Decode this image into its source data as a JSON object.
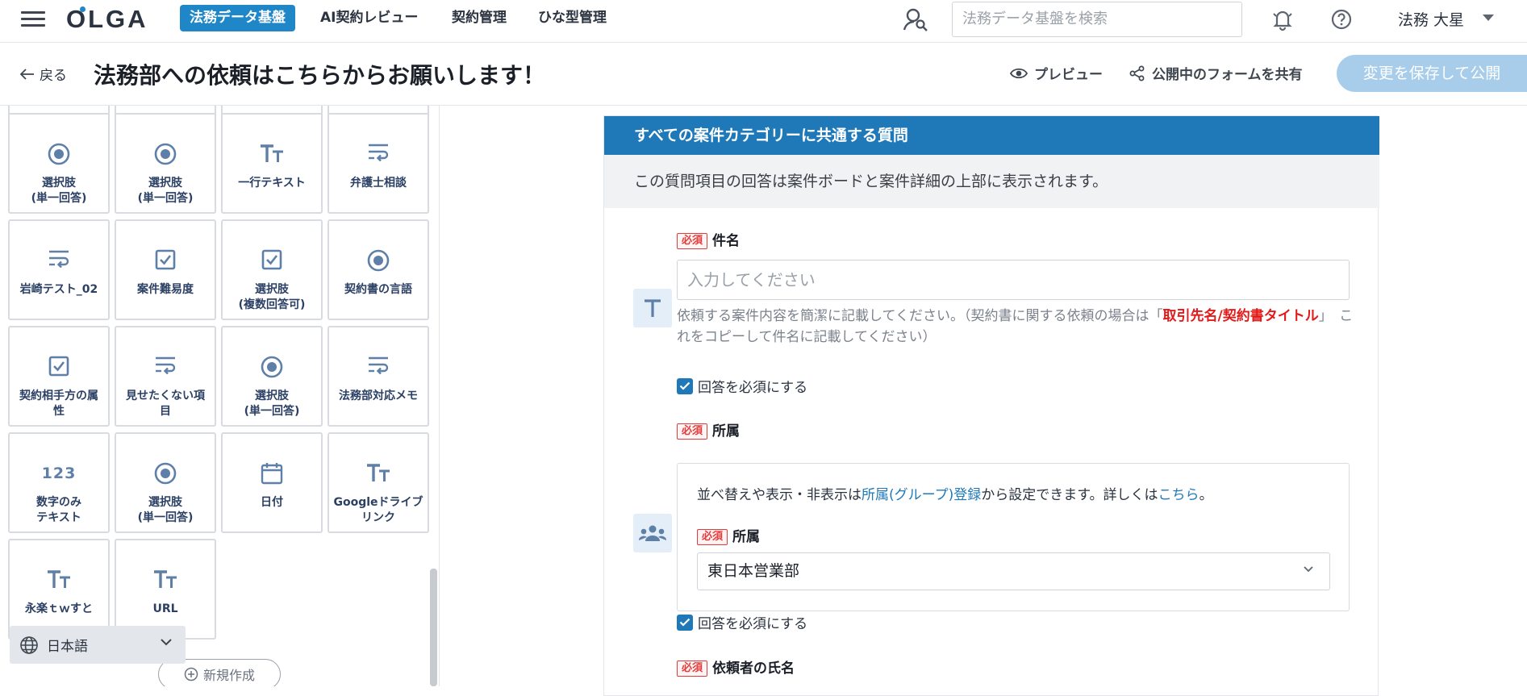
{
  "topnav": {
    "logo": "OLGA",
    "tabs": [
      {
        "label": "法務データ基盤",
        "active": true
      },
      {
        "label": "AI契約レビュー",
        "active": false
      },
      {
        "label": "契約管理",
        "active": false
      },
      {
        "label": "ひな型管理",
        "active": false
      }
    ],
    "search_placeholder": "法務データ基盤を検索",
    "user_name": "法務 大星",
    "brand_color": "#1f86c8"
  },
  "titlebar": {
    "back_label": "戻る",
    "title": "法務部への依頼はこちらからお願いします！",
    "preview_label": "プレビュー",
    "share_label": "公開中のフォームを共有",
    "publish_label": "変更を保存して公開"
  },
  "palette": {
    "tiles": [
      {
        "icon": "radio-icon",
        "label": "選択肢\n(単一回答)"
      },
      {
        "icon": "radio-icon",
        "label": "選択肢\n(単一回答)"
      },
      {
        "icon": "text-size-icon",
        "label": "一行テキスト"
      },
      {
        "icon": "wrap-text-icon",
        "label": "弁護士相談"
      },
      {
        "icon": "wrap-text-icon",
        "label": "岩崎テスト_02"
      },
      {
        "icon": "checkbox-icon",
        "label": "案件難易度"
      },
      {
        "icon": "checkbox-icon",
        "label": "選択肢\n(複数回答可)"
      },
      {
        "icon": "radio-icon",
        "label": "契約書の言語"
      },
      {
        "icon": "checkbox-icon",
        "label": "契約相手方の属\n性"
      },
      {
        "icon": "wrap-text-icon",
        "label": "見せたくない項\n目"
      },
      {
        "icon": "radio-icon",
        "label": "選択肢\n(単一回答)"
      },
      {
        "icon": "wrap-text-icon",
        "label": "法務部対応メモ"
      },
      {
        "icon": "number-icon",
        "label": "数字のみ\nテキスト"
      },
      {
        "icon": "radio-icon",
        "label": "選択肢\n(単一回答)"
      },
      {
        "icon": "calendar-icon",
        "label": "日付"
      },
      {
        "icon": "text-size-icon",
        "label": "Googleドライブ\nリンク"
      },
      {
        "icon": "text-size-icon",
        "label": "永楽ｔｗすと"
      },
      {
        "icon": "text-size-icon",
        "label": "URL"
      }
    ],
    "number_glyph": "123",
    "language": "日本語",
    "new_label": "新規作成"
  },
  "form": {
    "section_title": "すべての案件カテゴリーに共通する質問",
    "section_desc": "この質問項目の回答は案件ボードと案件詳細の上部に表示されます。",
    "required_badge": "必須",
    "q1": {
      "label": "件名",
      "placeholder": "入力してください",
      "help_prefix": "依頼する案件内容を簡潔に記載してください。（契約書に関する依頼の場合は「",
      "help_red": "取引先名/契約書タイトル",
      "help_suffix": "」　これをコピーして件名に記載してください）",
      "required_check": "回答を必須にする"
    },
    "q2": {
      "label": "所属",
      "note_prefix": "並べ替えや表示・非表示は",
      "note_link1": "所属(グループ)登録",
      "note_mid": "から設定できます。詳しくは",
      "note_link2": "こちら",
      "note_suffix": "。",
      "inner_label": "所属",
      "selected": "東日本営業部",
      "required_check": "回答を必須にする"
    },
    "q3": {
      "label": "依頼者の氏名"
    }
  }
}
